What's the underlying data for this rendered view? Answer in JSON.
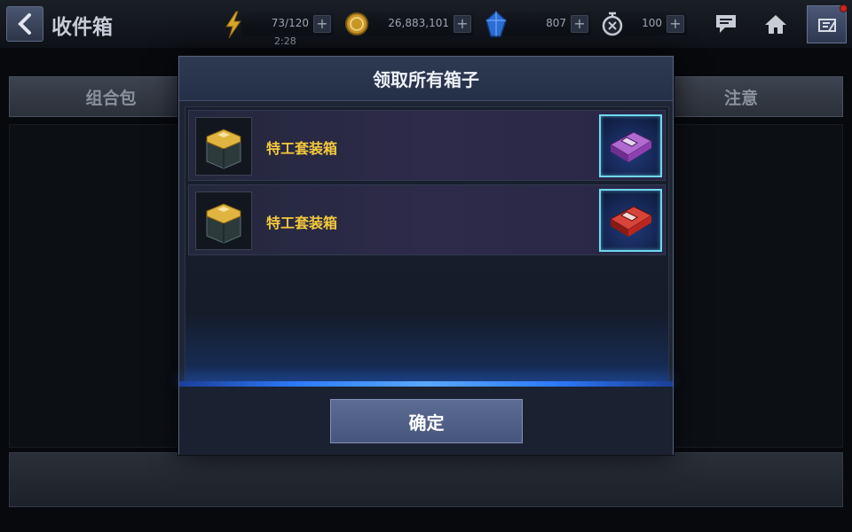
{
  "header": {
    "title": "收件箱",
    "resources": {
      "energy": {
        "value": "73/120",
        "timer": "2:28",
        "icon": "lightning-bolt-icon",
        "add_label": "+"
      },
      "gold": {
        "value": "26,883,101",
        "icon": "gold-coin-icon",
        "add_label": "+"
      },
      "crystal": {
        "value": "807",
        "icon": "blue-crystal-icon",
        "add_label": "+"
      },
      "stamina": {
        "value": "100",
        "icon": "stopwatch-icon",
        "add_label": "+"
      }
    }
  },
  "background": {
    "tab_left": "组合包",
    "tab_right": "注意"
  },
  "modal": {
    "title": "领取所有箱子",
    "rewards": [
      {
        "name": "特工套装箱",
        "item_color": "#8e3fb0"
      },
      {
        "name": "特工套装箱",
        "item_color": "#b9261f"
      }
    ],
    "confirm_label": "确定"
  },
  "colors": {
    "reward_name": "#f3c93c",
    "item_frame": "#6fd8ee",
    "accent_glow": "#2e7cff",
    "notification": "#c8281e"
  }
}
